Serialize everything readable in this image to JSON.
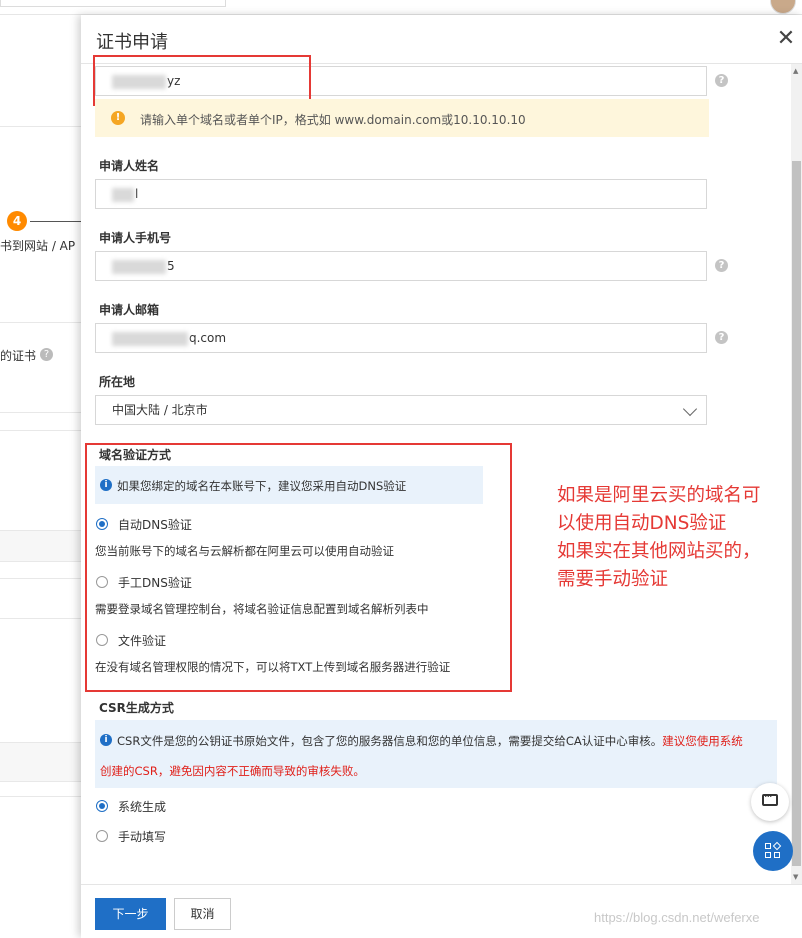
{
  "drawer": {
    "title": "证书申请",
    "domain_value": "yz",
    "domain_hint": "请输入单个域名或者单个IP，格式如 www.domain.com或10.10.10.10",
    "applicant_name_label": "申请人姓名",
    "applicant_name_value": "l",
    "applicant_phone_label": "申请人手机号",
    "applicant_phone_value": "5",
    "applicant_email_label": "申请人邮箱",
    "applicant_email_value": "q.com",
    "location_label": "所在地",
    "location_value": "中国大陆 / 北京市",
    "verify_section_label": "域名验证方式",
    "verify_info": "如果您绑定的域名在本账号下，建议您采用自动DNS验证",
    "verify_options": [
      {
        "label": "自动DNS验证",
        "desc": "您当前账号下的域名与云解析都在阿里云可以使用自动验证",
        "checked": true
      },
      {
        "label": "手工DNS验证",
        "desc": "需要登录域名管理控制台，将域名验证信息配置到域名解析列表中",
        "checked": false
      },
      {
        "label": "文件验证",
        "desc": "在没有域名管理权限的情况下，可以将TXT上传到域名服务器进行验证",
        "checked": false
      }
    ],
    "csr_section_label": "CSR生成方式",
    "csr_info_line1": "CSR文件是您的公钥证书原始文件，包含了您的服务器信息和您的单位信息，需要提交给CA认证中心审核。",
    "csr_info_line1_red": "建议您使用系统",
    "csr_info_line2_red": "创建的CSR，避免因内容不正确而导致的审核失败。",
    "csr_options": [
      {
        "label": "系统生成",
        "checked": true
      },
      {
        "label": "手动填写",
        "checked": false
      }
    ],
    "next_button": "下一步",
    "cancel_button": "取消"
  },
  "annotation": {
    "line1": "如果是阿里云买的域名可",
    "line2": "以使用自动DNS验证",
    "line3": "如果实在其他网站买的，",
    "line4": "需要手动验证"
  },
  "background": {
    "step_number": "4",
    "step_text": "书到网站 / AP",
    "cert_text": "的证书"
  },
  "watermark": "https://blog.csdn.net/weferxe",
  "colors": {
    "primary": "#1f6fc6",
    "annotation_red": "#e53935",
    "warning_bg": "#fef6dc",
    "info_bg": "#e9f2fb"
  }
}
